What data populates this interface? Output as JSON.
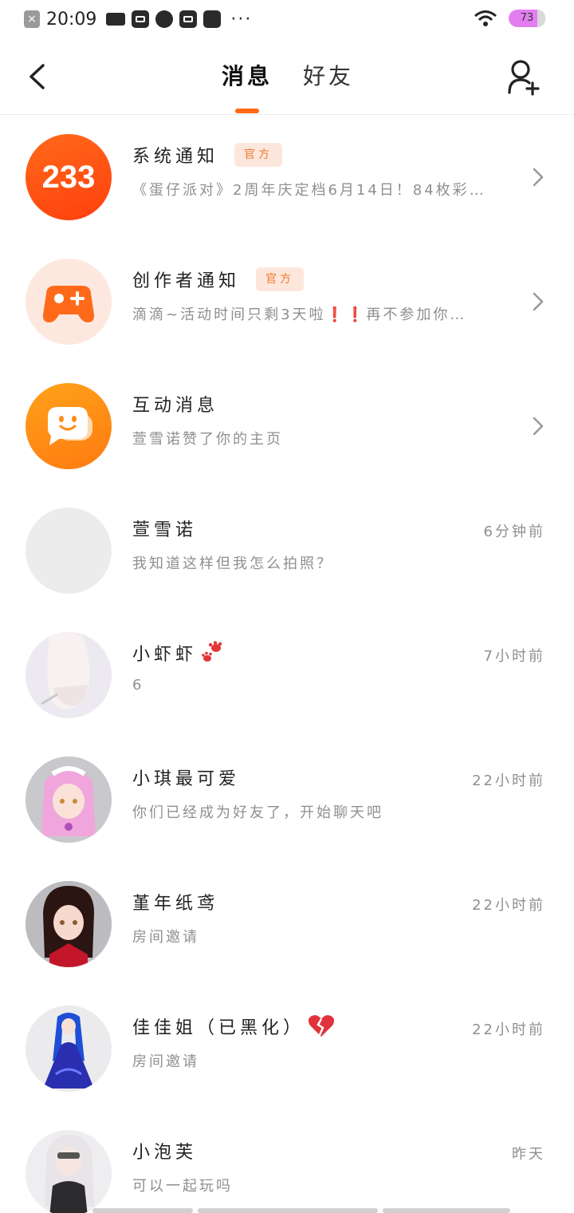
{
  "status_bar": {
    "time": "20:09",
    "dots": "···",
    "battery": "73"
  },
  "header": {
    "tabs": [
      {
        "label": "消息",
        "active": true
      },
      {
        "label": "好友",
        "active": false
      }
    ],
    "accent_color": "#ff6a13"
  },
  "messages": [
    {
      "name": "系统通知",
      "badge": "官方",
      "preview": "《蛋仔派对》2周年庆定档6月14日！84枚彩…",
      "time": "",
      "avatar": "233-logo-icon",
      "avatar_text": "233",
      "has_chevron": true
    },
    {
      "name": "创作者通知",
      "badge": "官方",
      "preview": "滴滴~活动时间只剩3天啦❗❗再不参加你…",
      "time": "",
      "avatar": "gamepad-plus-icon",
      "has_chevron": true
    },
    {
      "name": "互动消息",
      "badge": "",
      "preview": "萱雪诺赞了你的主页",
      "time": "",
      "avatar": "smile-chat-icon",
      "has_chevron": true
    },
    {
      "name": "萱雪诺",
      "badge": "",
      "preview": "我知道这样但我怎么拍照？",
      "time": "6分钟前",
      "avatar": "blank-avatar",
      "has_chevron": false
    },
    {
      "name": "小虾虾",
      "badge": "",
      "preview": "6",
      "time": "7小时前",
      "avatar": "white-hair-avatar",
      "has_chevron": false
    },
    {
      "name": "小琪最可爱",
      "badge": "",
      "preview": "你们已经成为好友了，开始聊天吧",
      "time": "22小时前",
      "avatar": "pink-maid-avatar",
      "has_chevron": false
    },
    {
      "name": "堇年纸鸢",
      "badge": "",
      "preview": "房间邀请",
      "time": "22小时前",
      "avatar": "dark-hair-avatar",
      "has_chevron": false
    },
    {
      "name": "佳佳姐（已黑化）",
      "badge": "",
      "preview": "房间邀请",
      "time": "22小时前",
      "avatar": "blue-hair-avatar",
      "has_chevron": false
    },
    {
      "name": "小泡芙",
      "badge": "",
      "preview": "可以一起玩吗",
      "time": "昨天",
      "avatar": "silver-hair-avatar",
      "has_chevron": false
    }
  ]
}
